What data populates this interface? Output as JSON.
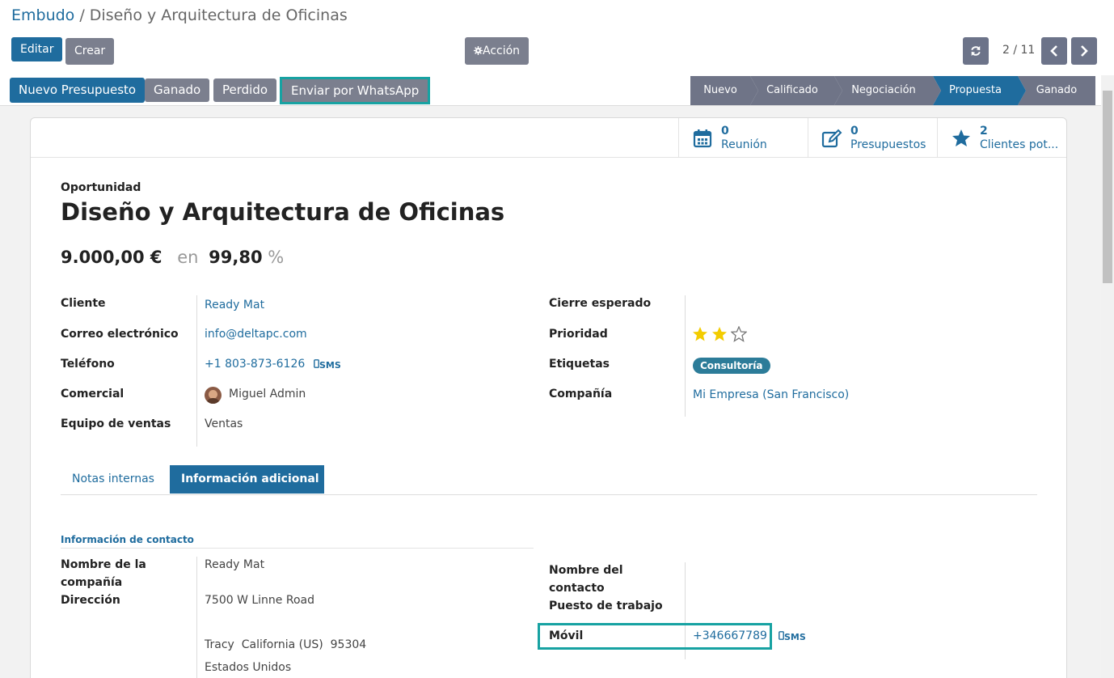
{
  "breadcrumb": {
    "root": "Embudo",
    "separator": " / ",
    "current": "Diseño y Arquitectura de Oficinas"
  },
  "toolbar": {
    "edit": "Editar",
    "create": "Crear",
    "action": "Acción",
    "action_icon": "gear-icon"
  },
  "pager": {
    "value": "2 / 11",
    "prev_icon": "chevron-left-icon",
    "next_icon": "chevron-right-icon",
    "reload_icon": "refresh-icon"
  },
  "header_buttons": {
    "quote": "Nuevo Presupuesto",
    "won": "Ganado",
    "lost": "Perdido",
    "whatsapp": "Enviar por WhatsApp"
  },
  "stages": [
    "Nuevo",
    "Calificado",
    "Negociación",
    "Propuesta",
    "Ganado"
  ],
  "active_stage": "Propuesta",
  "stats": [
    {
      "count": "0",
      "label": "Reunión",
      "icon": "calendar-icon"
    },
    {
      "count": "0",
      "label": "Presupuestos",
      "icon": "edit-icon"
    },
    {
      "count": "2",
      "label": "Clientes pot...",
      "icon": "star-icon"
    }
  ],
  "form": {
    "kind": "Oportunidad",
    "title": "Diseño y Arquitectura de Oficinas",
    "revenue": "9.000,00 €",
    "at": "en",
    "probability": "99,80",
    "percent": "%",
    "left": {
      "customer_label": "Cliente",
      "customer": "Ready Mat",
      "email_label": "Correo electrónico",
      "email": "info@deltapc.com",
      "phone_label": "Teléfono",
      "phone": "+1 803-873-6126",
      "sms": "SMS",
      "salesperson_label": "Comercial",
      "salesperson": "Miguel Admin",
      "team_label": "Equipo de ventas",
      "team": "Ventas"
    },
    "right": {
      "deadline_label": "Cierre esperado",
      "deadline": "",
      "priority_label": "Prioridad",
      "priority": 2,
      "priority_max": 3,
      "tags_label": "Etiquetas",
      "tag": "Consultoría",
      "company_label": "Compañía",
      "company": "Mi Empresa (San Francisco)"
    }
  },
  "tabs": {
    "notes": "Notas internas",
    "extra": "Información adicional"
  },
  "contact": {
    "section": "Información de contacto",
    "company_name_label_1": "Nombre de la",
    "company_name_label_2": "compañía",
    "company_name": "Ready Mat",
    "address_label": "Dirección",
    "street": "7500 W Linne Road",
    "city": "Tracy",
    "state": "California (US)",
    "zip": "95304",
    "country": "Estados Unidos",
    "contact_name_label_1": "Nombre del",
    "contact_name_label_2": "contacto",
    "job_label": "Puesto de trabajo",
    "mobile_label": "Móvil",
    "mobile": "+346667789",
    "sms": "SMS"
  },
  "colors": {
    "primary": "#1f6c9e",
    "stage": "#6f7487",
    "highlight": "#17a2a2",
    "star": "#f3cc00",
    "tag": "#2c7c99"
  }
}
